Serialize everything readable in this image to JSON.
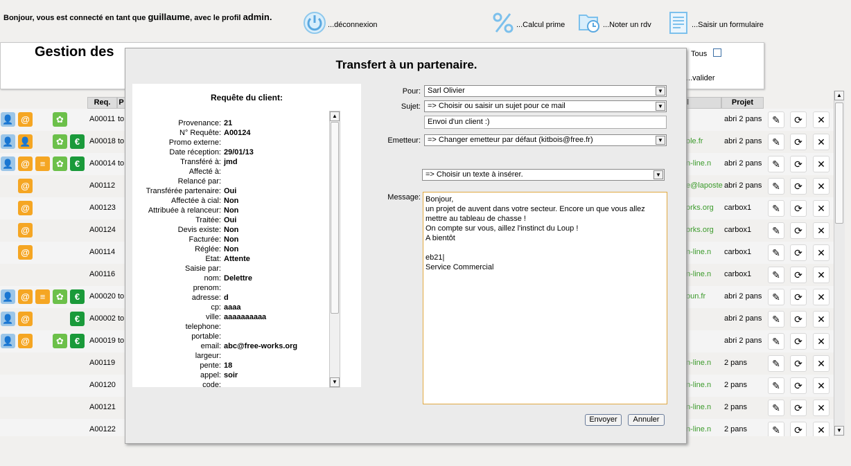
{
  "header": {
    "welcome_prefix": "Bonjour, vous est connecté en tant que",
    "user": "guillaume",
    "welcome_mid": ", avec le profil",
    "profile": "admin.",
    "buttons": [
      {
        "label": "...déconnexion",
        "icon": "power-icon"
      },
      {
        "label": "...Calcul prime",
        "icon": "percent-icon"
      },
      {
        "label": "...Noter un rdv",
        "icon": "folder-clock-icon"
      },
      {
        "label": "...Saisir un formulaire",
        "icon": "form-icon"
      }
    ]
  },
  "background": {
    "title": "Gestion des",
    "tous_label": "Tous",
    "valider_label": "...valider",
    "columns": {
      "req": "Req.",
      "p": "P",
      "il": "il",
      "projet": "Projet"
    },
    "rows": [
      {
        "req": "A00011",
        "c2": "to",
        "mail": "",
        "projet": "abri 2 pans"
      },
      {
        "req": "A00018",
        "c2": "to",
        "mail": "ole.fr",
        "projet": "abri 2 pans"
      },
      {
        "req": "A00014",
        "c2": "to",
        "mail": "n-line.n",
        "projet": "abri 2 pans"
      },
      {
        "req": "A00112",
        "c2": "",
        "mail": "e@laposte",
        "projet": "abri 2 pans"
      },
      {
        "req": "A00123",
        "c2": "",
        "mail": "orks.org",
        "projet": "carbox1"
      },
      {
        "req": "A00124",
        "c2": "",
        "mail": "orks.org",
        "projet": "carbox1"
      },
      {
        "req": "A00114",
        "c2": "",
        "mail": "n-line.n",
        "projet": "carbox1"
      },
      {
        "req": "A00116",
        "c2": "",
        "mail": "n-line.n",
        "projet": "carbox1"
      },
      {
        "req": "A00020",
        "c2": "to",
        "mail": "oun.fr",
        "projet": "abri 2 pans"
      },
      {
        "req": "A00002",
        "c2": "to",
        "mail": "",
        "projet": "abri 2 pans"
      },
      {
        "req": "A00019",
        "c2": "to",
        "mail": "",
        "projet": "abri 2 pans"
      },
      {
        "req": "A00119",
        "c2": "",
        "mail": "n-line.n",
        "projet": "2 pans"
      },
      {
        "req": "A00120",
        "c2": "",
        "mail": "n-line.n",
        "projet": "2 pans"
      },
      {
        "req": "A00121",
        "c2": "",
        "mail": "n-line.n",
        "projet": "2 pans"
      },
      {
        "req": "A00122",
        "c2": "",
        "mail": "n-line.n",
        "projet": "2 pans"
      }
    ],
    "row_actions": {
      "edit": "✎",
      "transfer": "⟳",
      "delete": "✕"
    }
  },
  "modal": {
    "title": "Transfert à un partenaire.",
    "request_title": "Requête du client:",
    "fields": [
      {
        "k": "Provenance:",
        "v": "21"
      },
      {
        "k": "N° Requête:",
        "v": "A00124"
      },
      {
        "k": "Promo externe:",
        "v": ""
      },
      {
        "k": "Date réception:",
        "v": "29/01/13"
      },
      {
        "k": "Transféré à:",
        "v": "jmd"
      },
      {
        "k": "Affecté à:",
        "v": ""
      },
      {
        "k": "Relancé par:",
        "v": ""
      },
      {
        "k": "Transférée partenaire:",
        "v": "Oui"
      },
      {
        "k": "Affectée à cial:",
        "v": "Non"
      },
      {
        "k": "Attribuée à relanceur:",
        "v": "Non"
      },
      {
        "k": "Traitée:",
        "v": "Oui"
      },
      {
        "k": "Devis existe:",
        "v": "Non"
      },
      {
        "k": "Facturée:",
        "v": "Non"
      },
      {
        "k": "Réglée:",
        "v": "Non"
      },
      {
        "k": "Etat:",
        "v": "Attente"
      },
      {
        "k": "Saisie par:",
        "v": ""
      },
      {
        "k": "nom:",
        "v": "Delettre"
      },
      {
        "k": "prenom:",
        "v": ""
      },
      {
        "k": "adresse:",
        "v": "d"
      },
      {
        "k": "cp:",
        "v": "aaaa"
      },
      {
        "k": "ville:",
        "v": "aaaaaaaaaa"
      },
      {
        "k": "telephone:",
        "v": ""
      },
      {
        "k": "portable:",
        "v": ""
      },
      {
        "k": "email:",
        "v": "abc@free-works.org"
      },
      {
        "k": "largeur:",
        "v": ""
      },
      {
        "k": "pente:",
        "v": "18"
      },
      {
        "k": "appel:",
        "v": "soir"
      },
      {
        "k": "code:",
        "v": ""
      }
    ],
    "form": {
      "pour_label": "Pour:",
      "pour_value": "Sarl Olivier",
      "sujet_label": "Sujet:",
      "sujet_value": "=> Choisir ou saisir un sujet pour ce mail",
      "sujet_text": "Envoi d'un client :)",
      "emetteur_label": "Emetteur:",
      "emetteur_value": "=> Changer emetteur par défaut (kitbois@free.fr)",
      "texte_value": "=> Choisir un texte à insérer.",
      "message_label": "Message:",
      "message": "Bonjour,\nun projet de auvent dans votre secteur. Encore un que vous allez mettre au tableau de chasse !\nOn compte sur vous, aillez l'instinct du Loup !\nA bientôt\n\neb21|\nService Commercial",
      "envoyer": "Envoyer",
      "annuler": "Annuler"
    }
  }
}
